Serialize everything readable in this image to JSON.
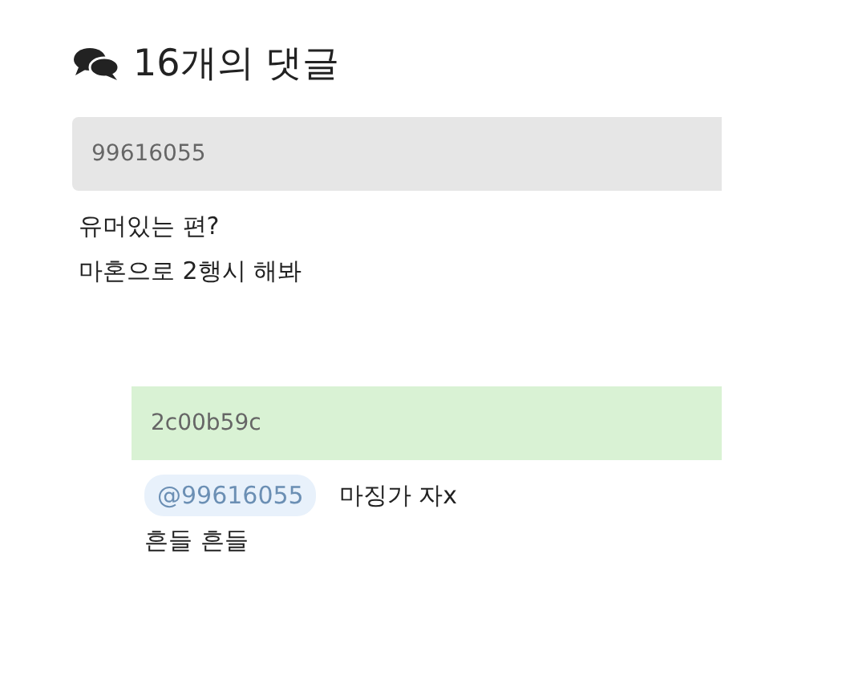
{
  "header": {
    "title": "16개의 댓글"
  },
  "comments": [
    {
      "kind": "comment",
      "author": "99616055",
      "lines": [
        "유머있는 편?",
        "마혼으로 2행시 해봐"
      ]
    },
    {
      "kind": "reply",
      "author": "2c00b59c",
      "mention": "@99616055",
      "lines": [
        "마징가 자x",
        "흔들 흔들"
      ]
    }
  ]
}
